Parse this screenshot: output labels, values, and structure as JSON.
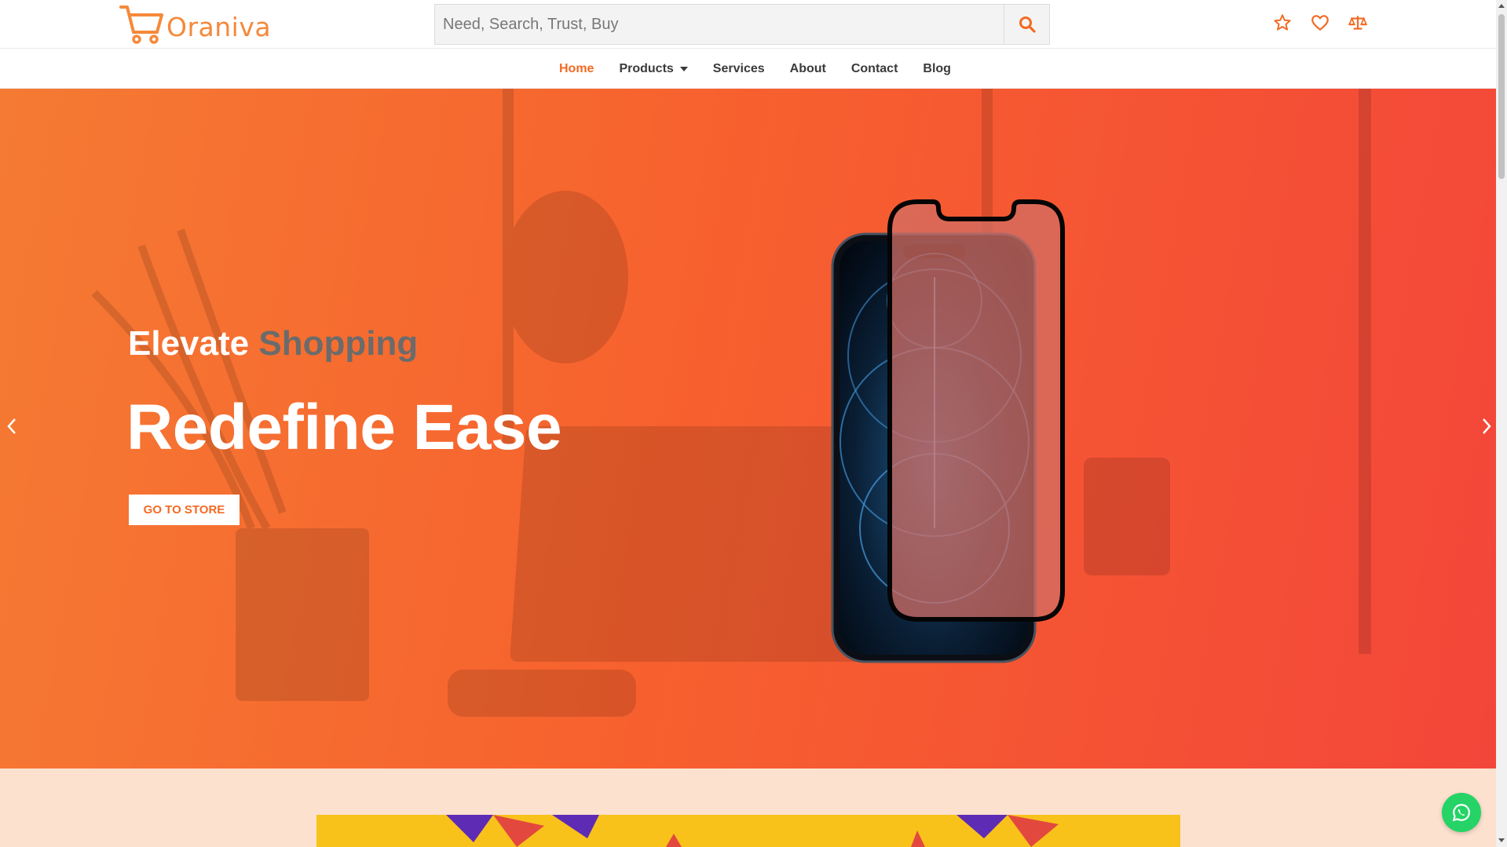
{
  "brand": {
    "name": "Oraniva",
    "color": "#f5893b"
  },
  "search": {
    "placeholder": "Need, Search, Trust, Buy",
    "button_icon": "search-icon"
  },
  "top_icons": [
    "star-icon",
    "heart-icon",
    "compare-scale-icon"
  ],
  "nav": {
    "items": [
      {
        "label": "Home",
        "active": true
      },
      {
        "label": "Products",
        "dropdown": true
      },
      {
        "label": "Services"
      },
      {
        "label": "About"
      },
      {
        "label": "Contact"
      },
      {
        "label": "Blog"
      }
    ]
  },
  "hero": {
    "subtitle_part1": "Elevate",
    "subtitle_part2": "Shopping",
    "title": "Redefine Ease",
    "button_label": "GO TO STORE",
    "accent_color": "#f36a23",
    "prev_icon": "chevron-left-icon",
    "next_icon": "chevron-right-icon"
  },
  "floating": {
    "icon": "whatsapp-icon",
    "color": "#25d366"
  }
}
